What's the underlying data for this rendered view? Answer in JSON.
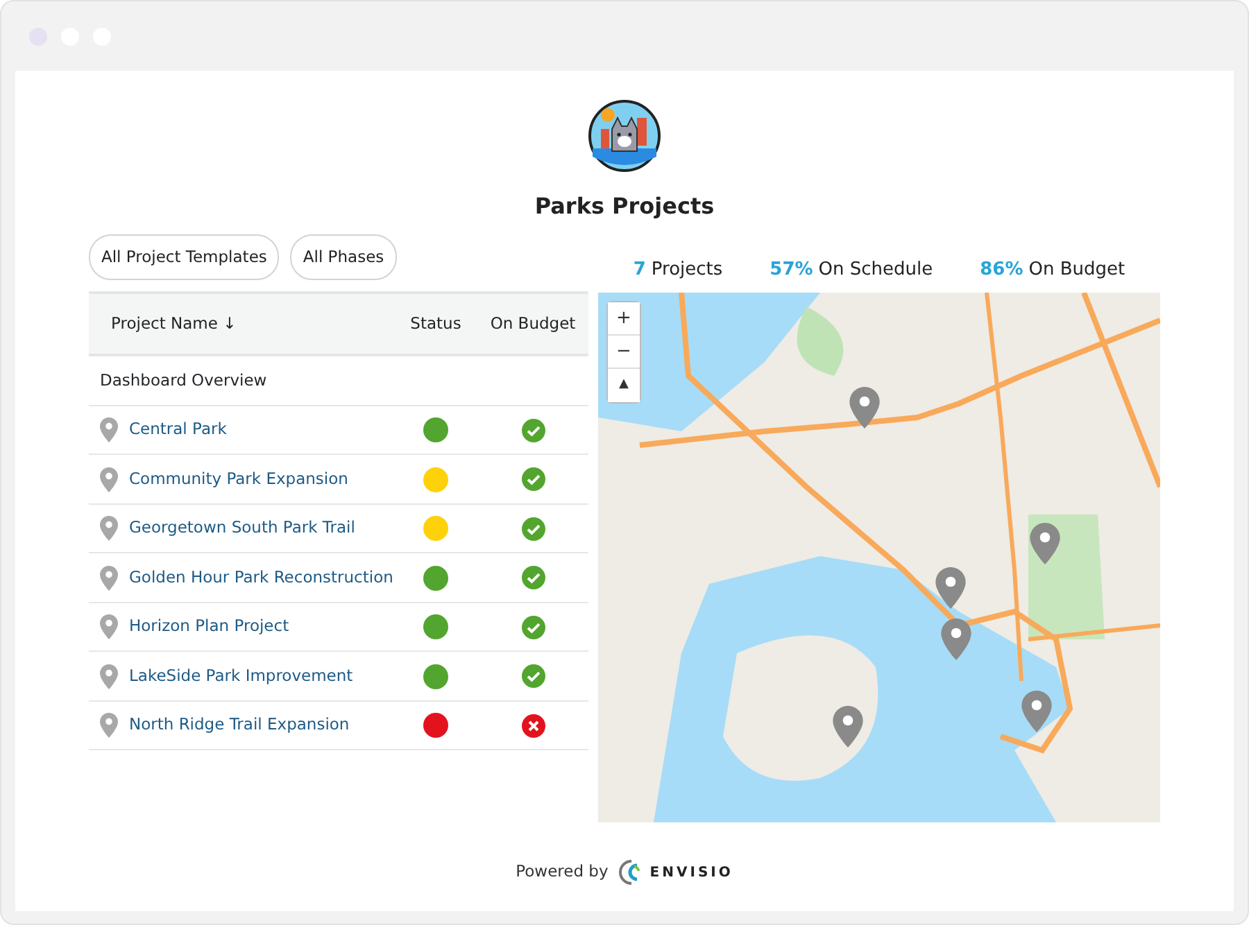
{
  "title": "Parks Projects",
  "filters": [
    {
      "label": "All Project Templates"
    },
    {
      "label": "All Phases"
    }
  ],
  "summary": [
    {
      "value": "7",
      "label": "Projects"
    },
    {
      "value": "57%",
      "label": "On Schedule"
    },
    {
      "value": "86%",
      "label": "On Budget"
    }
  ],
  "table": {
    "columns": [
      "Project Name ↓",
      "Status",
      "On Budget"
    ],
    "group": "Dashboard Overview",
    "rows": [
      {
        "name": "Central Park",
        "color": "#52a52e",
        "on_budget": true
      },
      {
        "name": "Community Park Expansion",
        "color": "#fdd20a",
        "on_budget": true
      },
      {
        "name": "Georgetown South Park Trail",
        "color": "#fdd20a",
        "on_budget": true
      },
      {
        "name": "Golden Hour Park Reconstruction",
        "color": "#52a52e",
        "on_budget": true
      },
      {
        "name": "Horizon Plan Project",
        "color": "#52a52e",
        "on_budget": true
      },
      {
        "name": "LakeSide Park Improvement",
        "color": "#52a52e",
        "on_budget": true
      },
      {
        "name": "North Ridge Trail Expansion",
        "color": "#e3131e",
        "on_budget": false
      }
    ]
  },
  "map": {
    "controls": [
      "+",
      "−",
      "▲"
    ]
  },
  "footer": {
    "text": "Powered by",
    "brand": "ENVISIO"
  }
}
